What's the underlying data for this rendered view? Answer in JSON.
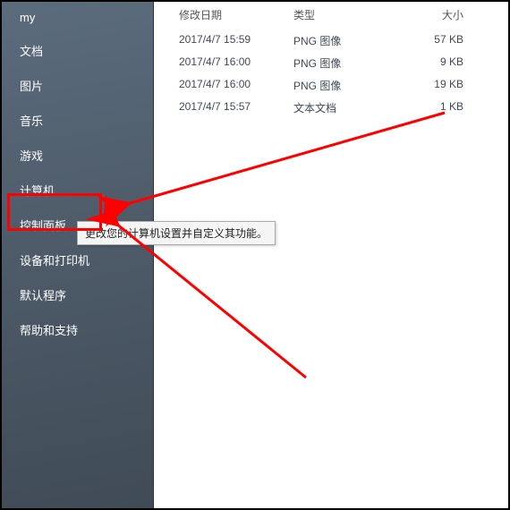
{
  "sidebar": {
    "items": [
      {
        "label": "my"
      },
      {
        "label": "文档"
      },
      {
        "label": "图片"
      },
      {
        "label": "音乐"
      },
      {
        "label": "游戏"
      },
      {
        "label": "计算机"
      },
      {
        "label": "控制面板"
      },
      {
        "label": "设备和打印机"
      },
      {
        "label": "默认程序"
      },
      {
        "label": "帮助和支持"
      }
    ]
  },
  "columns": {
    "date": "修改日期",
    "type": "类型",
    "size": "大小"
  },
  "files": [
    {
      "date": "2017/4/7 15:59",
      "type": "PNG 图像",
      "size": "57 KB"
    },
    {
      "date": "2017/4/7 16:00",
      "type": "PNG 图像",
      "size": "9 KB"
    },
    {
      "date": "2017/4/7 16:00",
      "type": "PNG 图像",
      "size": "19 KB"
    },
    {
      "date": "2017/4/7 15:57",
      "type": "文本文档",
      "size": "1 KB"
    }
  ],
  "tooltip": "更改您的计算机设置并自定义其功能。",
  "annotation": {
    "color": "#ff0000"
  }
}
